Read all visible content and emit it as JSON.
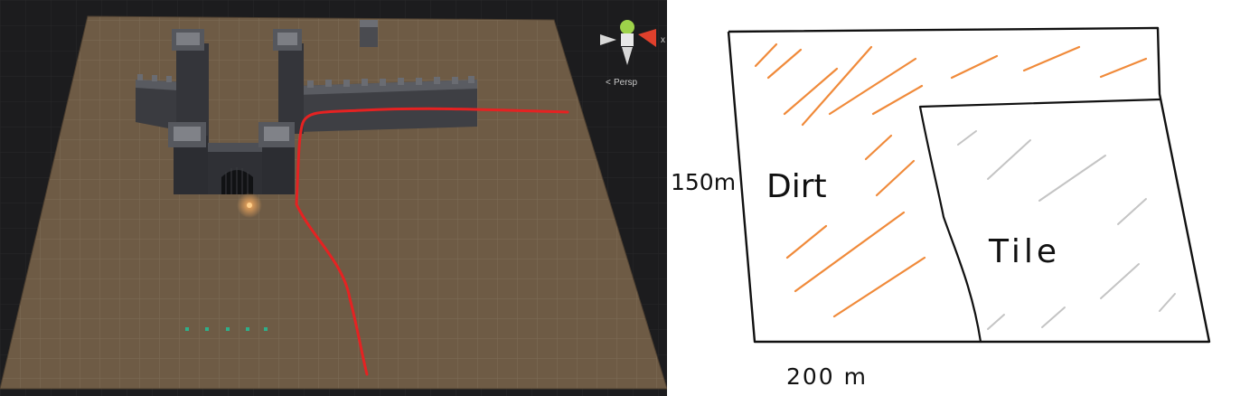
{
  "scene_view": {
    "projection_label": "Persp",
    "gizmo_axis_label": "x"
  },
  "sketch": {
    "height_label": "150m",
    "width_label": "200 m",
    "dirt_label": "Dirt",
    "tile_label": "Tile"
  },
  "colors": {
    "path_line": "#e52222",
    "dirt_hatch": "#f08a3a",
    "tile_hatch": "#c4c4c4",
    "terrain": "#6e5b45"
  }
}
